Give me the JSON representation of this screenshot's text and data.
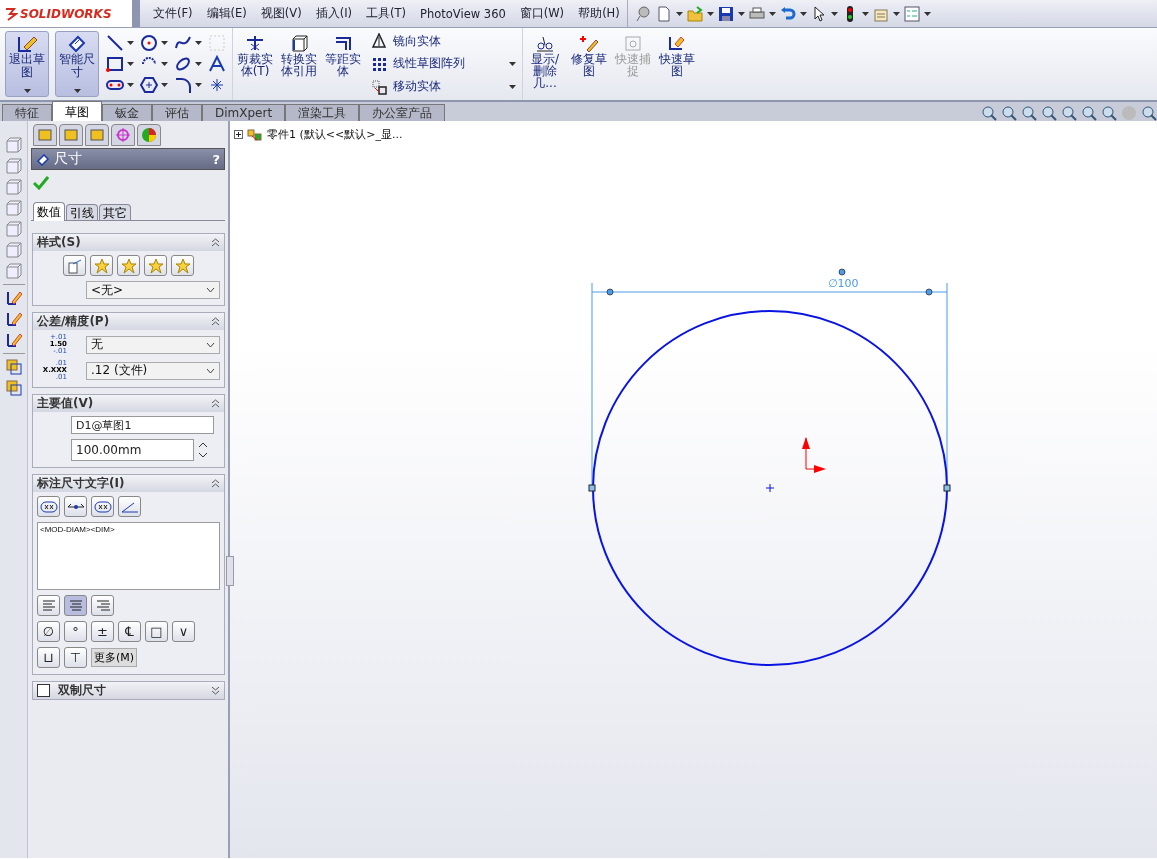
{
  "logo": "SOLIDWORKS",
  "menu": [
    "文件(F)",
    "编辑(E)",
    "视图(V)",
    "插入(I)",
    "工具(T)",
    "PhotoView 360",
    "窗口(W)",
    "帮助(H)"
  ],
  "ribbon": {
    "big": [
      {
        "label": "退出草图",
        "selected": true
      },
      {
        "label": "智能尺寸",
        "selected": true
      }
    ],
    "mid": [
      {
        "label": "剪裁实体(T)",
        "disabled": false
      },
      {
        "label": "转换实体引用",
        "disabled": false
      },
      {
        "label": "等距实体",
        "disabled": false
      }
    ],
    "list": [
      "镜向实体",
      "线性草图阵列",
      "移动实体"
    ],
    "right": [
      {
        "label": "显示/删除几...",
        "disabled": false
      },
      {
        "label": "修复草图",
        "disabled": false
      },
      {
        "label": "快速捕捉",
        "disabled": true
      },
      {
        "label": "快速草图",
        "disabled": false
      }
    ]
  },
  "tabs": [
    {
      "label": "特征",
      "selected": false
    },
    {
      "label": "草图",
      "selected": true
    },
    {
      "label": "钣金",
      "selected": false
    },
    {
      "label": "评估",
      "selected": false
    },
    {
      "label": "DimXpert",
      "selected": false
    },
    {
      "label": "渲染工具",
      "selected": false
    },
    {
      "label": "办公室产品",
      "selected": false
    }
  ],
  "tree": {
    "label": "零件1  (默认<<默认>_显..."
  },
  "panel": {
    "title": "尺寸",
    "help": "?",
    "tabs": [
      {
        "label": "数值",
        "selected": true
      },
      {
        "label": "引线",
        "selected": false
      },
      {
        "label": "其它",
        "selected": false
      }
    ],
    "style": {
      "title": "样式(S)",
      "value": "<无>"
    },
    "tolerance": {
      "title": "公差/精度(P)",
      "rows": [
        {
          "sample": [
            "+.01",
            "1.50",
            "-.01"
          ],
          "value": "无"
        },
        {
          "sample": [
            ".01",
            "X.XXX",
            ".01"
          ],
          "value": ".12 (文件)"
        }
      ]
    },
    "primary": {
      "title": "主要值(V)",
      "name": "D1@草图1",
      "value": "100.00mm"
    },
    "text": {
      "title": "标注尺寸文字(I)",
      "content": "<MOD-DIAM><DIM>",
      "align": [
        {
          "selected": false
        },
        {
          "selected": true
        },
        {
          "selected": false
        }
      ],
      "symbols": [
        "∅",
        "°",
        "±",
        "℄",
        "□",
        "∨"
      ],
      "symbols2": [
        "⊔",
        "⊤"
      ],
      "more": "更多(M)"
    },
    "dual": {
      "title": "双制尺寸",
      "checked": false
    }
  },
  "canvas": {
    "dimension": "∅100"
  }
}
